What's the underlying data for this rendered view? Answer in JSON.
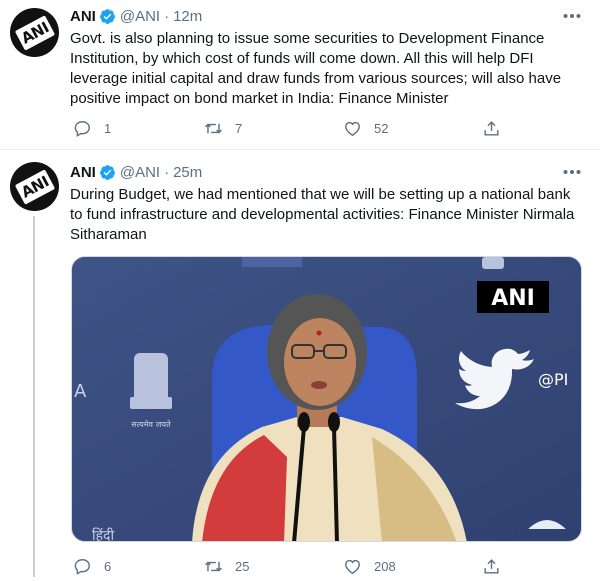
{
  "tweets": [
    {
      "name": "ANI",
      "handle": "@ANI",
      "separator": "·",
      "time": "12m",
      "avatar_label": "ANI",
      "text": "Govt. is also planning to issue some securities to Development Finance Institution, by which cost of funds will come down. All this will help DFI leverage initial capital and draw funds from various sources; will also have positive impact on bond market in India: Finance Minister",
      "replies": "1",
      "retweets": "7",
      "likes": "52"
    },
    {
      "name": "ANI",
      "handle": "@ANI",
      "separator": "·",
      "time": "25m",
      "avatar_label": "ANI",
      "text": "During Budget, we had mentioned that we will be setting up a national bank to fund infrastructure and developmental activities: Finance Minister Nirmala Sitharaman",
      "media": {
        "watermark": "ANI",
        "backdrop_handle": "@PI",
        "emblem_caption": "सत्यमेव जयते",
        "backdrop_letter": "A",
        "backdrop_hindi": "हिंदी",
        "twitter_icon": "twitter-bird-icon"
      },
      "replies": "6",
      "retweets": "25",
      "likes": "208"
    }
  ],
  "colors": {
    "verified": "#1da1f2",
    "muted": "#5b7083",
    "text": "#0f1419",
    "border": "#e6ecf0"
  }
}
